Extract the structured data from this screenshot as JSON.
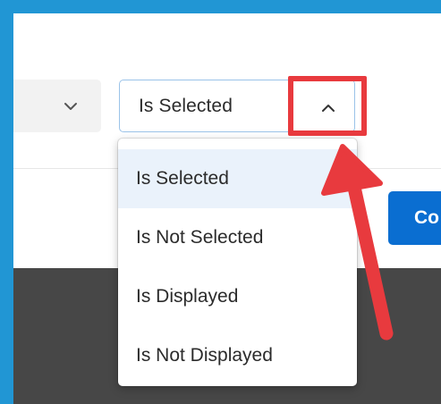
{
  "condition_select": {
    "value": "Is Selected"
  },
  "dropdown": {
    "options": [
      {
        "label": "Is Selected",
        "selected": true
      },
      {
        "label": "Is Not Selected",
        "selected": false
      },
      {
        "label": "Is Displayed",
        "selected": false
      },
      {
        "label": "Is Not Displayed",
        "selected": false
      }
    ]
  },
  "confirm_button": {
    "label_visible": "Co"
  },
  "colors": {
    "frame": "#2196d4",
    "accent": "#0a6ed1",
    "annotation": "#e83a3e",
    "dark_panel": "#474747"
  },
  "icons": {
    "left_select": "chevron-down-icon",
    "condition_select": "chevron-up-icon"
  }
}
